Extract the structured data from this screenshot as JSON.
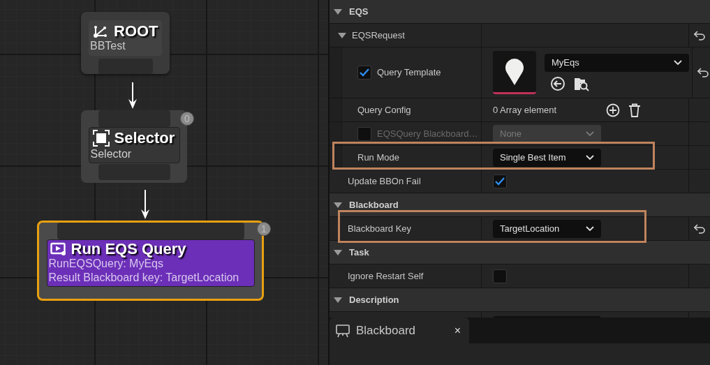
{
  "graph": {
    "nodes": [
      {
        "kind": "root",
        "title": "ROOT",
        "subtitle": "BBTest"
      },
      {
        "kind": "composite",
        "title": "Selector",
        "subtitle": "Selector",
        "index": "0",
        "selected": false
      },
      {
        "kind": "task",
        "title": "Run EQS Query",
        "lines": [
          "RunEQSQuery: MyEqs",
          "Result Blackboard key: TargetLocation"
        ],
        "index": "1",
        "selected": true
      }
    ]
  },
  "details": {
    "sections": [
      {
        "label": "EQS",
        "expanded": true,
        "rows": [
          {
            "kind": "group",
            "label": "EQSRequest",
            "expanded": true,
            "resettable": true,
            "children": [
              {
                "kind": "asset",
                "label": "Query Template",
                "checked": true,
                "value": "MyEqs",
                "resettable": true
              },
              {
                "kind": "array",
                "label": "Query Config",
                "value": "0 Array element"
              },
              {
                "kind": "dropdown",
                "label": "EQSQuery Blackboard…",
                "checked": false,
                "disabled": true,
                "value": "None"
              },
              {
                "kind": "dropdown",
                "label": "Run Mode",
                "value": "Single Best Item",
                "highlighted": true
              }
            ]
          },
          {
            "kind": "checkbox",
            "label": "Update BBOn Fail",
            "checked": true
          }
        ]
      },
      {
        "label": "Blackboard",
        "expanded": true,
        "rows": [
          {
            "kind": "dropdown",
            "label": "Blackboard Key",
            "value": "TargetLocation",
            "highlighted": true,
            "resettable": true
          }
        ]
      },
      {
        "label": "Task",
        "expanded": true,
        "rows": [
          {
            "kind": "checkbox",
            "label": "Ignore Restart Self",
            "checked": false
          }
        ]
      },
      {
        "label": "Description",
        "expanded": true
      }
    ]
  },
  "bottom_tab": {
    "label": "Blackboard",
    "close_glyph": "×"
  }
}
